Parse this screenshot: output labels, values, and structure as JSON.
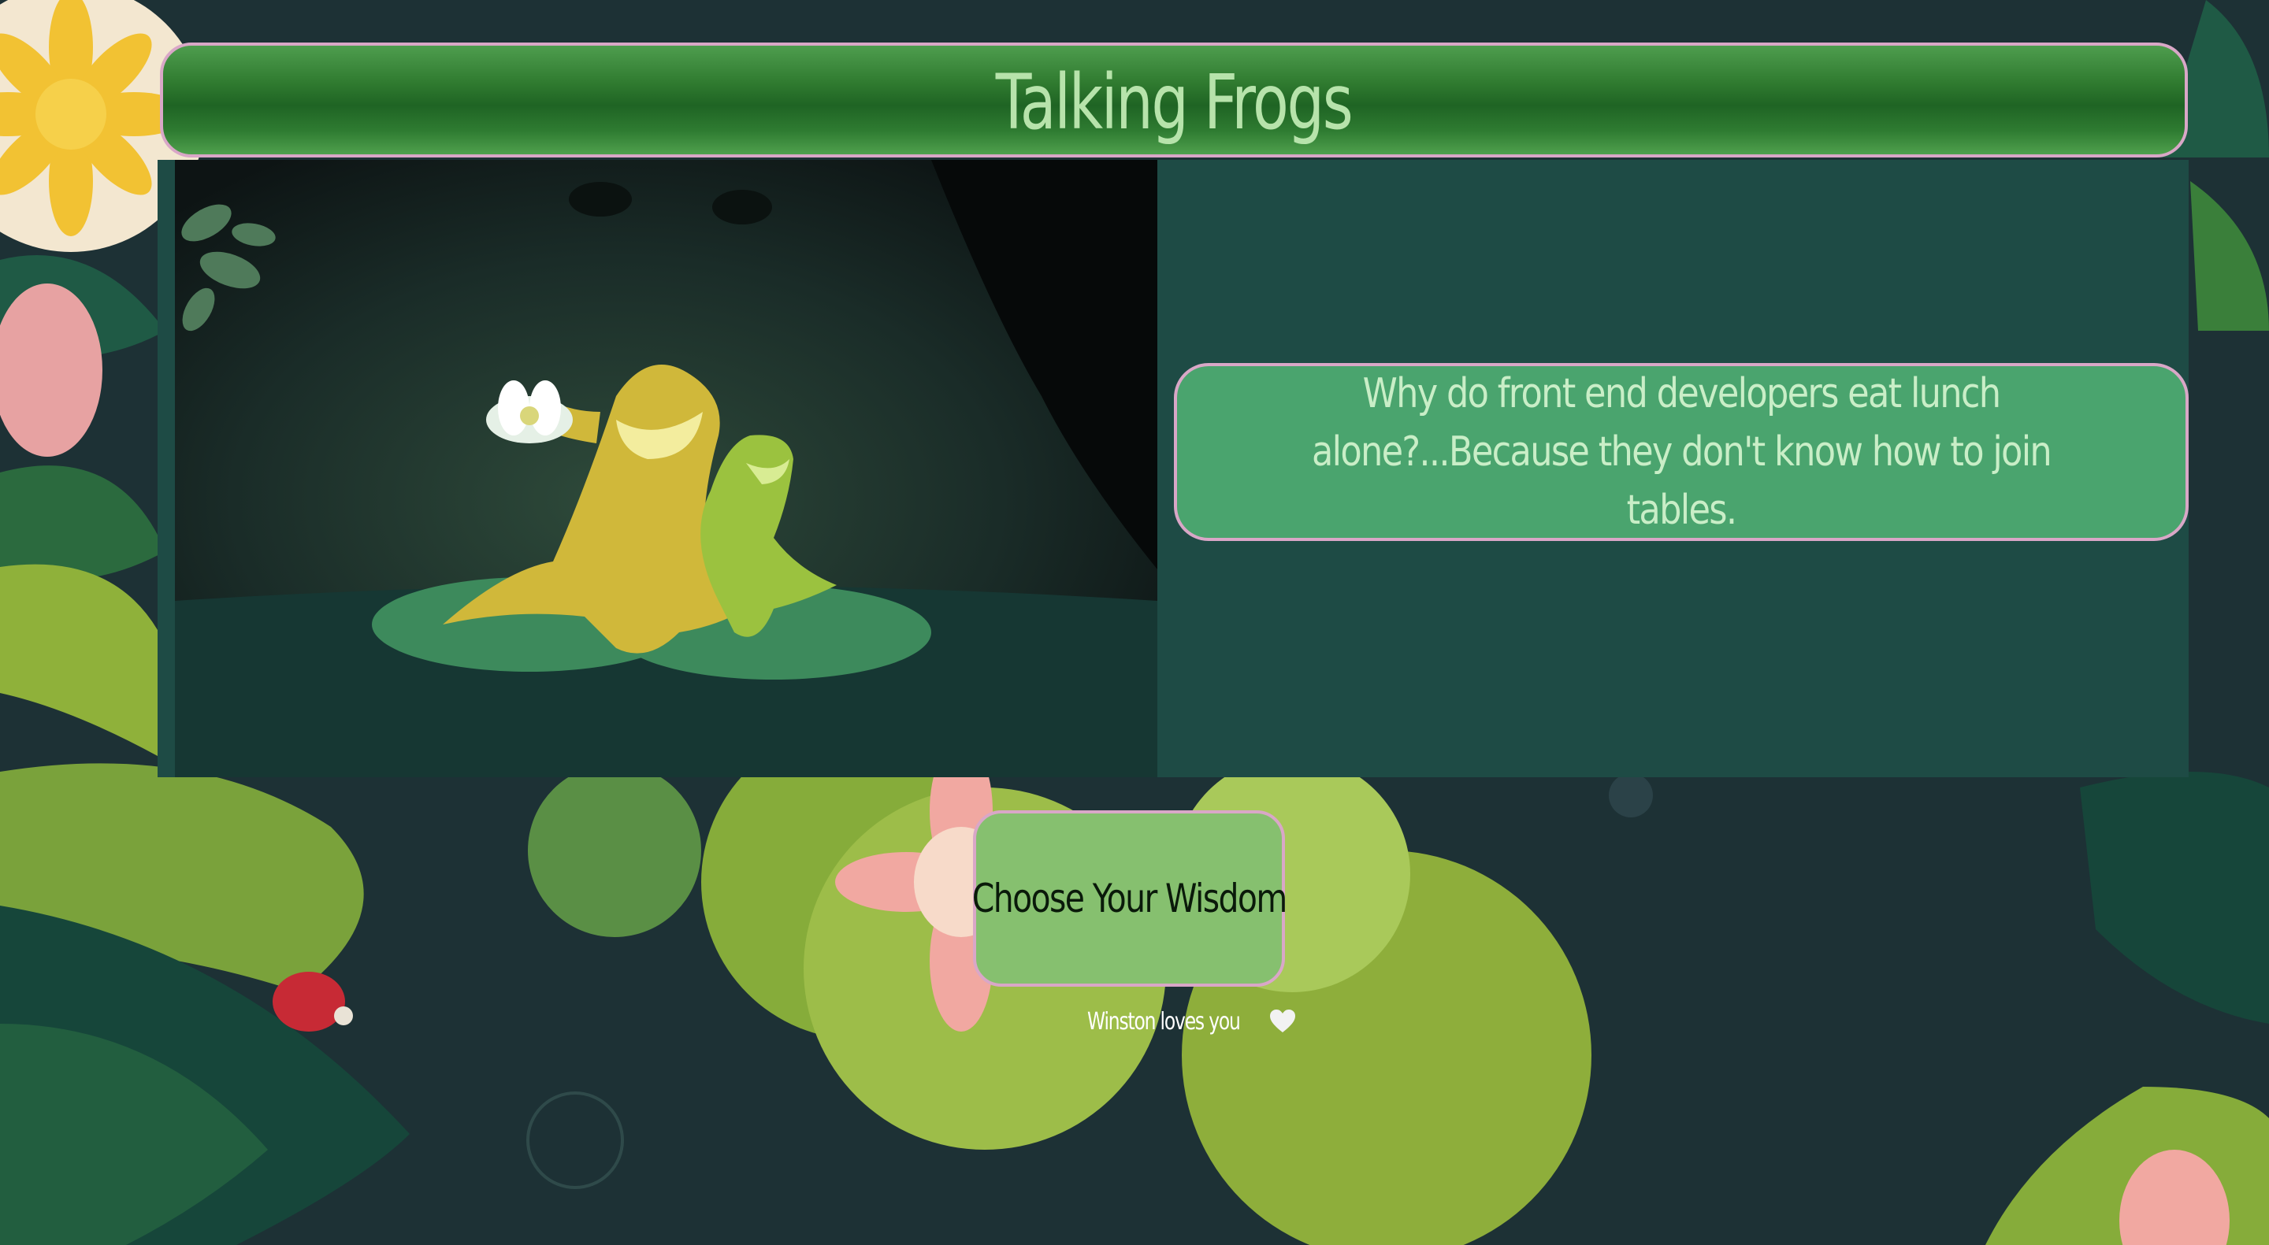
{
  "header": {
    "title": "Talking Frogs"
  },
  "joke": {
    "text": "Why do front end developers eat lunch alone?...Because they don't know how to join tables."
  },
  "controls": {
    "choose_button_label": "Choose Your Wisdom"
  },
  "footer": {
    "text": "Winston loves you",
    "heart_icon": "white-heart-icon"
  },
  "colors": {
    "title_gradient_dark": "#1f6424",
    "title_gradient_light": "#4fa04d",
    "title_text": "#b7e3ab",
    "border_pink": "#d9a7c7",
    "panel_teal": "#1e4b45",
    "joke_box": "#4aa46e",
    "joke_text": "#c9eec7",
    "button_bg": "#86c06f",
    "page_bg": "#1c2f33"
  }
}
